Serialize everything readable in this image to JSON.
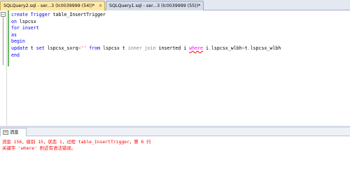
{
  "tabs": [
    {
      "label": "SQLQuery2.sql - ser...3 (lc0039999 (54))*",
      "active": true
    },
    {
      "label": "SQLQuery1.sql - ser...3 (lc0039999 (55))*",
      "active": false
    }
  ],
  "editor": {
    "lines": [
      [
        {
          "t": "create Trigger ",
          "c": "kw"
        },
        {
          "t": "table_InsertTrigger",
          "c": "plain"
        }
      ],
      [
        {
          "t": "on ",
          "c": "kw"
        },
        {
          "t": "lspcsx",
          "c": "plain"
        }
      ],
      [
        {
          "t": "for insert",
          "c": "kw"
        }
      ],
      [
        {
          "t": "as",
          "c": "kw"
        }
      ],
      [
        {
          "t": "begin",
          "c": "kw"
        }
      ],
      [
        {
          "t": "update ",
          "c": "kw"
        },
        {
          "t": "t ",
          "c": "plain"
        },
        {
          "t": "set ",
          "c": "kw"
        },
        {
          "t": "lspcsx_sxrq",
          "c": "plain"
        },
        {
          "t": "=",
          "c": "op"
        },
        {
          "t": "''",
          "c": "str"
        },
        {
          "t": " from ",
          "c": "kw"
        },
        {
          "t": "lspcsx t ",
          "c": "plain"
        },
        {
          "t": "inner join ",
          "c": "op"
        },
        {
          "t": "inserted i ",
          "c": "plain"
        },
        {
          "t": "where",
          "c": "err"
        },
        {
          "t": " i",
          "c": "plain"
        },
        {
          "t": ".",
          "c": "op"
        },
        {
          "t": "lspcsx_wlbh",
          "c": "plain"
        },
        {
          "t": "=",
          "c": "op"
        },
        {
          "t": "t",
          "c": "plain"
        },
        {
          "t": ".",
          "c": "op"
        },
        {
          "t": "lspcsx_wlbh",
          "c": "plain"
        }
      ],
      [
        {
          "t": "end",
          "c": "kw"
        }
      ]
    ]
  },
  "results": {
    "tab_label": "消息",
    "messages": [
      "消息 156，级别 15，状态 1，过程 table_InsertTrigger，第 6 行",
      "关键字 'where' 附近有语法错误。"
    ]
  },
  "colors": {
    "keyword": "#0000ff",
    "string": "#ff0000",
    "error_text": "#ff0000",
    "active_tab": "#ffe8a6"
  }
}
